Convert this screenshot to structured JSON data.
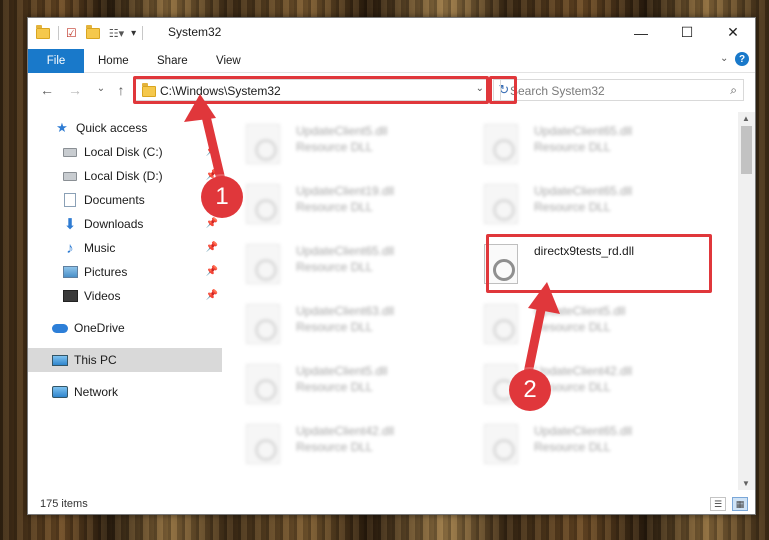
{
  "window": {
    "title": "System32"
  },
  "controls": {
    "minimize": "—",
    "maximize": "☐",
    "close": "✕"
  },
  "ribbon": {
    "tabs": [
      "File",
      "Home",
      "Share",
      "View"
    ],
    "help": "?"
  },
  "nav": {
    "back": "←",
    "forward": "→",
    "recent": "⌄",
    "up": "↑"
  },
  "address": {
    "path": "C:\\Windows\\System32",
    "dropdown": "⌄",
    "refresh": "↻"
  },
  "search": {
    "placeholder": "Search System32",
    "icon": "search-icon"
  },
  "sidebar": {
    "items": [
      {
        "label": "Quick access",
        "icon": "star-icon"
      },
      {
        "label": "Local Disk (C:)",
        "icon": "disk-icon",
        "pinned": true
      },
      {
        "label": "Local Disk (D:)",
        "icon": "disk-icon",
        "pinned": true
      },
      {
        "label": "Documents",
        "icon": "documents-icon",
        "pinned": true
      },
      {
        "label": "Downloads",
        "icon": "downloads-icon",
        "pinned": true
      },
      {
        "label": "Music",
        "icon": "music-icon",
        "pinned": true
      },
      {
        "label": "Pictures",
        "icon": "pictures-icon",
        "pinned": true
      },
      {
        "label": "Videos",
        "icon": "videos-icon",
        "pinned": true
      },
      {
        "label": "OneDrive",
        "icon": "onedrive-icon"
      },
      {
        "label": "This PC",
        "icon": "this-pc-icon",
        "selected": true
      },
      {
        "label": "Network",
        "icon": "network-icon"
      }
    ],
    "pin_glyph": "📌"
  },
  "files": {
    "left_column": [
      {
        "name": "UpdateClient5.dll",
        "type": "Resource DLL"
      },
      {
        "name": "UpdateClient19.dll",
        "type": "Resource DLL"
      },
      {
        "name": "UpdateClient65.dll",
        "type": "Resource DLL"
      },
      {
        "name": "UpdateClient63.dll",
        "type": "Resource DLL"
      },
      {
        "name": "UpdateClient5.dll",
        "type": "Resource DLL"
      },
      {
        "name": "UpdateClient42.dll",
        "type": "Resource DLL"
      }
    ],
    "right_column": [
      {
        "name": "UpdateClient65.dll",
        "type": "Resource DLL"
      },
      {
        "name": "UpdateClient65.dll",
        "type": "Resource DLL"
      },
      {
        "name": "directx9tests_rd.dll",
        "type": ""
      },
      {
        "name": "UpdateClient5.dll",
        "type": "Resource DLL"
      },
      {
        "name": "UpdateClient42.dll",
        "type": "Resource DLL"
      },
      {
        "name": "UpdateClient65.dll",
        "type": "Resource DLL"
      }
    ]
  },
  "status": {
    "items_count": "175 items"
  },
  "annotations": {
    "badge1": "1",
    "badge2": "2",
    "color": "#e0373b"
  },
  "colors": {
    "accent": "#1979ca",
    "highlight": "#e0373b"
  }
}
